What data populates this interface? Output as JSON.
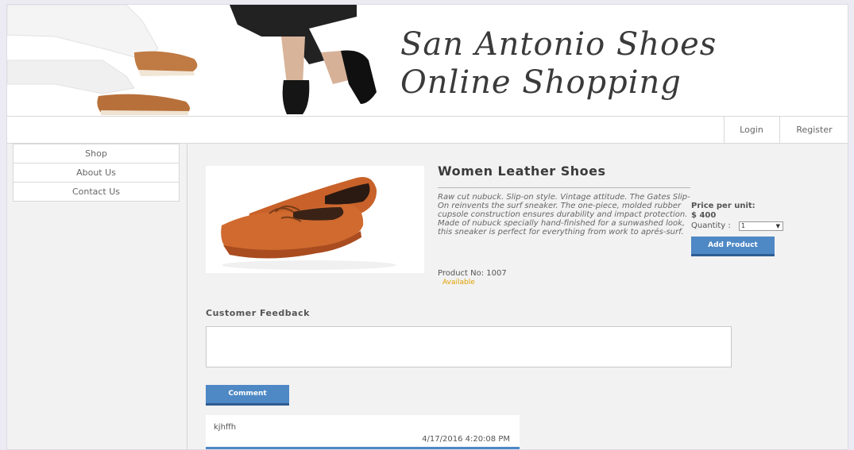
{
  "banner": {
    "title": "San Antonio Shoes\nOnline Shopping"
  },
  "nav": {
    "login": "Login",
    "register": "Register"
  },
  "sidebar": {
    "items": [
      {
        "label": "Shop"
      },
      {
        "label": "About Us"
      },
      {
        "label": "Contact Us"
      }
    ]
  },
  "product": {
    "title": "Women Leather Shoes",
    "description": "Raw cut nubuck. Slip-on style. Vintage attitude. The Gates Slip-On reinvents the surf sneaker. The one-piece, molded rubber cupsole construction ensures durability and impact protection. Made of nubuck specially hand-finished for a sunwashed look, this sneaker is perfect for everything from work to aprés-surf.",
    "product_no": "Product No: 1007",
    "availability": "Available",
    "price_label": "Price per unit:",
    "price_value": "$ 400",
    "quantity_label": "Quantity :",
    "quantity_value": "1",
    "add_button": "Add Product"
  },
  "feedback": {
    "label": "Customer Feedback",
    "input_value": "",
    "comment_button": "Comment"
  },
  "comments": [
    {
      "author": "kjhffh",
      "timestamp": "4/17/2016 4:20:08 PM"
    }
  ],
  "colors": {
    "accent": "#4e88c5",
    "shoe": "#c8622a",
    "available": "#e0a000"
  }
}
